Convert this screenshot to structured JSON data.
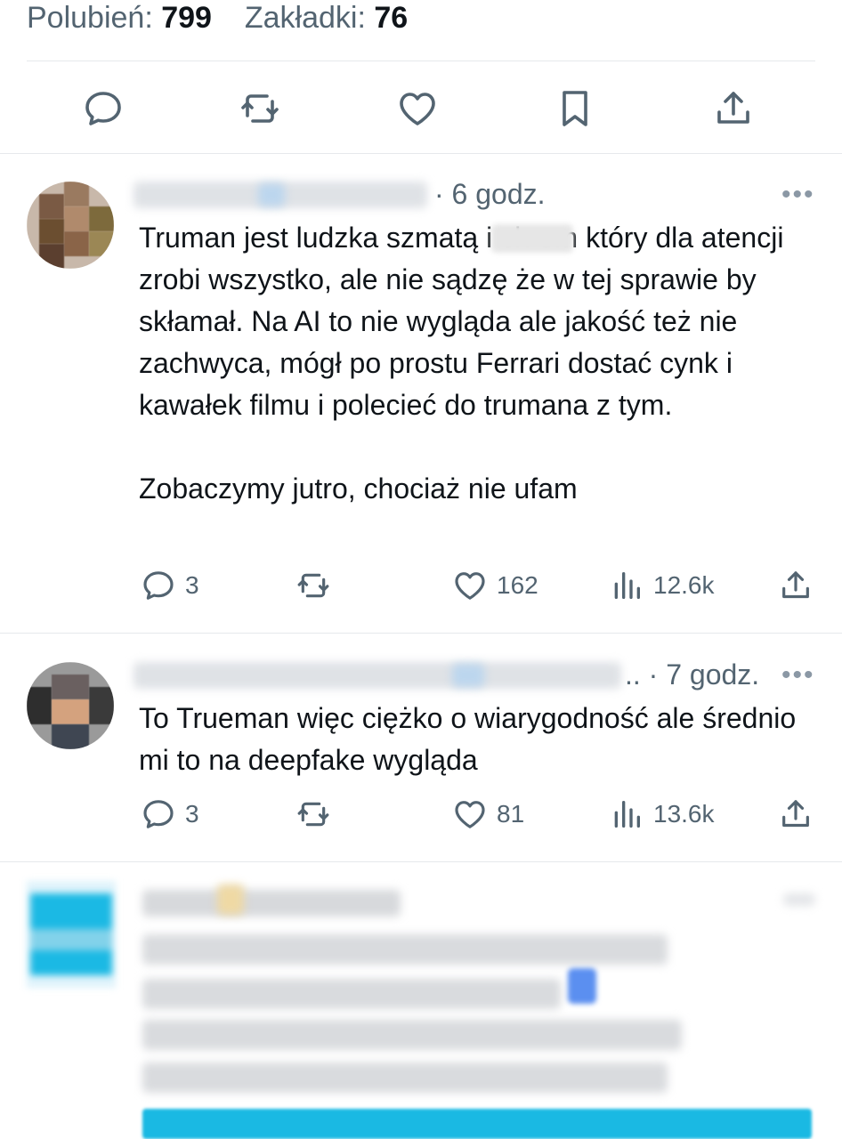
{
  "stats": {
    "likes_label": "Polubień:",
    "likes_count": "799",
    "bookmarks_label": "Zakładki:",
    "bookmarks_count": "76"
  },
  "actions": [
    {
      "name": "reply-icon"
    },
    {
      "name": "retweet-icon"
    },
    {
      "name": "like-icon"
    },
    {
      "name": "bookmark-icon"
    },
    {
      "name": "share-icon"
    }
  ],
  "replies": [
    {
      "time": "· 6 godz.",
      "text": "Truman jest ludzka szmatą i ch       em który dla atencji zrobi wszystko, ale nie sądzę że w tej sprawie by skłamał. Na AI to nie wygląda ale jakość też nie zachwyca, mógł po prostu Ferrari dostać cynk i kawałek filmu i polecieć do trumana z tym.\n\nZobaczymy jutro, chociaż nie ufam",
      "replies_count": "3",
      "likes_count": "162",
      "views_count": "12.6k",
      "more": "•••"
    },
    {
      "time": ".. · 7 godz.",
      "text": "To Trueman więc ciężko o wiarygodność ale średnio mi to na deepfake wygląda",
      "replies_count": "3",
      "likes_count": "81",
      "views_count": "13.6k",
      "more": "•••"
    }
  ],
  "colors": {
    "text": "#0f1419",
    "secondary": "#536471",
    "divider": "#e6e9ec",
    "icon": "#536471"
  }
}
